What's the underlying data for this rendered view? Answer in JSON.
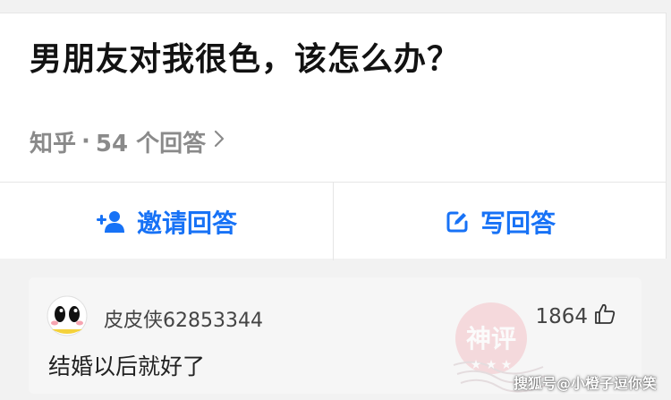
{
  "question": {
    "title": "男朋友对我很色，该怎么办？",
    "source": "知乎",
    "separator": "·",
    "answer_count": "54 个回答",
    "chevron_icon": "chevron-right-icon"
  },
  "actions": {
    "invite": {
      "label": "邀请回答",
      "icon": "add-user-icon"
    },
    "write": {
      "label": "写回答",
      "icon": "edit-icon"
    },
    "accent_color": "#1772f6"
  },
  "answer": {
    "username": "皮皮侠62853344",
    "likes": "1864",
    "like_icon": "thumbs-up-icon",
    "text": "结婚以后就好了"
  },
  "stamp": {
    "text": "神评"
  },
  "watermark": "搜狐号@小橙子逗你笑"
}
